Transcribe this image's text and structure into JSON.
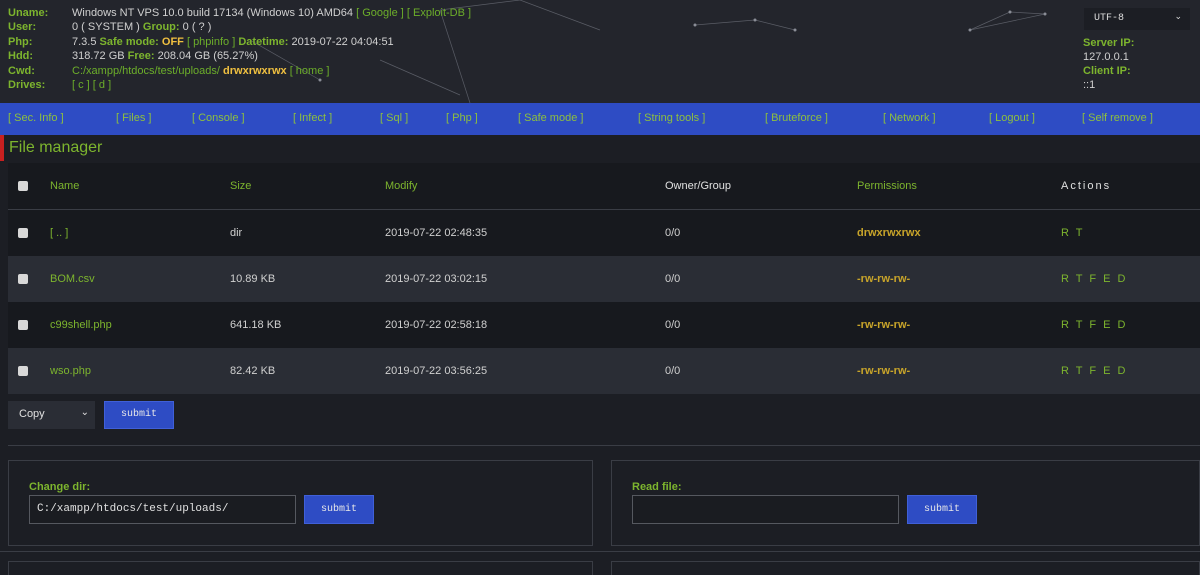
{
  "header": {
    "labels": [
      "Uname:",
      "User:",
      "Php:",
      "Hdd:",
      "Cwd:",
      "Drives:"
    ],
    "uname": "Windows NT VPS 10.0 build 17134 (Windows 10) AMD64",
    "uname_links": [
      "[ Google ]",
      "[ Exploit-DB ]"
    ],
    "user": "0 ( SYSTEM )",
    "group_label": "Group:",
    "group": "0 ( ? )",
    "php_version": "7.3.5",
    "safe_mode_label": "Safe mode:",
    "safe_mode": "OFF",
    "phpinfo_link": "[ phpinfo ]",
    "datetime_label": "Datetime:",
    "datetime": "2019-07-22 04:04:51",
    "hdd_total": "318.72 GB",
    "free_label": "Free:",
    "hdd_free": "208.04 GB (65.27%)",
    "cwd": "C:/xampp/htdocs/test/uploads/",
    "cwd_perm": "drwxrwxrwx",
    "home_link": "[ home ]",
    "drives": "[ c ] [ d ]",
    "charset": "UTF-8",
    "server_ip_label": "Server IP:",
    "server_ip": "127.0.0.1",
    "client_ip_label": "Client IP:",
    "client_ip": "::1"
  },
  "menu": {
    "items": [
      "[ Sec. Info ]",
      "[ Files ]",
      "[ Console ]",
      "[ Infect ]",
      "[ Sql ]",
      "[ Php ]",
      "[ Safe mode ]",
      "[ String tools ]",
      "[ Bruteforce ]",
      "[ Network ]",
      "[ Logout ]",
      "[ Self remove ]"
    ]
  },
  "file_manager": {
    "title": "File manager",
    "columns": [
      "Name",
      "Size",
      "Modify",
      "Owner/Group",
      "Permissions",
      "Actions"
    ],
    "rows": [
      {
        "name": "[ .. ]",
        "size": "dir",
        "modify": "2019-07-22 02:48:35",
        "owner": "0/0",
        "perms": "drwxrwxrwx",
        "actions": "R T"
      },
      {
        "name": "BOM.csv",
        "size": "10.89 KB",
        "modify": "2019-07-22 03:02:15",
        "owner": "0/0",
        "perms": "-rw-rw-rw-",
        "actions": "R T F E D"
      },
      {
        "name": "c99shell.php",
        "size": "641.18 KB",
        "modify": "2019-07-22 02:58:18",
        "owner": "0/0",
        "perms": "-rw-rw-rw-",
        "actions": "R T F E D"
      },
      {
        "name": "wso.php",
        "size": "82.42 KB",
        "modify": "2019-07-22 03:56:25",
        "owner": "0/0",
        "perms": "-rw-rw-rw-",
        "actions": "R T F E D"
      }
    ],
    "bulk_action": "Copy",
    "submit_label": "submit"
  },
  "change_dir": {
    "label": "Change dir:",
    "value": "C:/xampp/htdocs/test/uploads/",
    "submit_label": "submit"
  },
  "read_file": {
    "label": "Read file:",
    "value": "",
    "submit_label": "submit"
  }
}
